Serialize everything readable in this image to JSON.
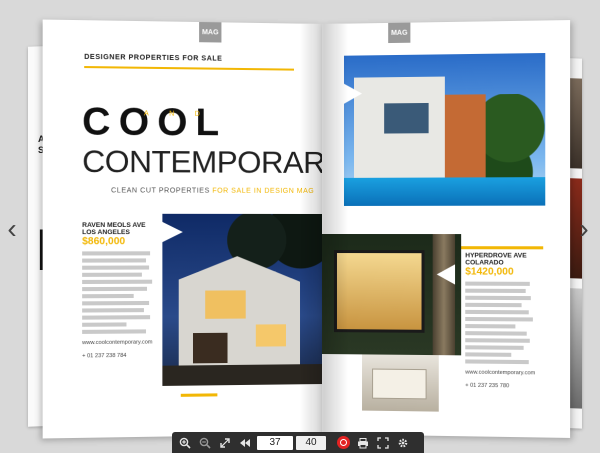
{
  "magazine": {
    "badge": "MAG",
    "left_page": {
      "section_title": "DESIGNER PROPERTIES FOR SALE",
      "headline_1": "COOL",
      "headline_and": "AND",
      "headline_2": "CONTEMPORARY",
      "tagline_a": "CLEAN CUT PROPERTIES",
      "tagline_b": "FOR SALE IN DESIGN MAG",
      "listing": {
        "title_1": "RAVEN MEOLS AVE",
        "title_2": "LOS ANGELES",
        "price": "$860,000",
        "website": "www.coolcontemporary.com",
        "phone": "+ 01 237 238 784"
      }
    },
    "right_page": {
      "listing": {
        "title_1": "HYPERDROVE AVE",
        "title_2": "COLARADO",
        "price": "$1420,000",
        "website": "www.coolcontemporary.com",
        "phone": "+ 01 237 235 780"
      }
    },
    "edge_text": "AN\nST"
  },
  "toolbar": {
    "current_page": "37",
    "total_page": "40"
  },
  "icons": {
    "zoom_in": "zoom-in-icon",
    "zoom_out": "zoom-out-icon",
    "fullscreen": "expand-icon",
    "first_page": "double-chevron-left-icon",
    "record": "record-icon",
    "print": "printer-icon",
    "fit": "fit-screen-icon",
    "settings": "gear-icon"
  },
  "colors": {
    "accent": "#f2b705",
    "toolbar": "#2f2f2f"
  }
}
